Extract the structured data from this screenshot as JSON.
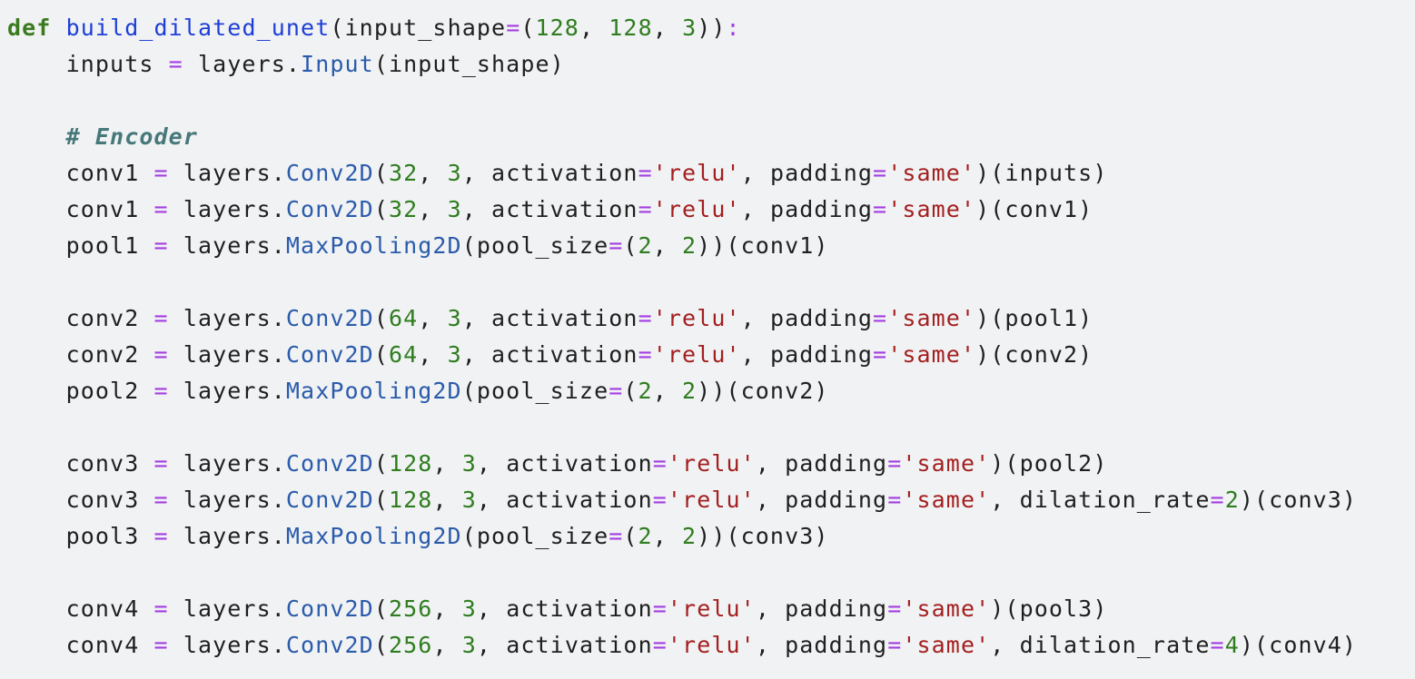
{
  "colors": {
    "background": "#f1f2f4",
    "text": "#1f1f1f",
    "keyword": "#3b7a1e",
    "function_name": "#1d3fd6",
    "class_name": "#2a5bab",
    "number": "#2f7d1f",
    "string": "#a31f1f",
    "operator": "#a43ee0",
    "comment": "#46787a"
  },
  "code_lines": [
    [
      [
        "kw",
        "def"
      ],
      [
        "tx",
        " "
      ],
      [
        "fn",
        "build_dilated_unet"
      ],
      [
        "tx",
        "(input_shape"
      ],
      [
        "op",
        "="
      ],
      [
        "tx",
        "("
      ],
      [
        "num",
        "128"
      ],
      [
        "tx",
        ", "
      ],
      [
        "num",
        "128"
      ],
      [
        "tx",
        ", "
      ],
      [
        "num",
        "3"
      ],
      [
        "tx",
        "))"
      ],
      [
        "op",
        ":"
      ]
    ],
    [
      [
        "tx",
        "    inputs "
      ],
      [
        "op",
        "="
      ],
      [
        "tx",
        " layers."
      ],
      [
        "cls",
        "Input"
      ],
      [
        "tx",
        "(input_shape)"
      ]
    ],
    [],
    [
      [
        "cm",
        "    # Encoder"
      ]
    ],
    [
      [
        "tx",
        "    conv1 "
      ],
      [
        "op",
        "="
      ],
      [
        "tx",
        " layers."
      ],
      [
        "cls",
        "Conv2D"
      ],
      [
        "tx",
        "("
      ],
      [
        "num",
        "32"
      ],
      [
        "tx",
        ", "
      ],
      [
        "num",
        "3"
      ],
      [
        "tx",
        ", activation"
      ],
      [
        "op",
        "="
      ],
      [
        "str",
        "'relu'"
      ],
      [
        "tx",
        ", padding"
      ],
      [
        "op",
        "="
      ],
      [
        "str",
        "'same'"
      ],
      [
        "tx",
        ")(inputs)"
      ]
    ],
    [
      [
        "tx",
        "    conv1 "
      ],
      [
        "op",
        "="
      ],
      [
        "tx",
        " layers."
      ],
      [
        "cls",
        "Conv2D"
      ],
      [
        "tx",
        "("
      ],
      [
        "num",
        "32"
      ],
      [
        "tx",
        ", "
      ],
      [
        "num",
        "3"
      ],
      [
        "tx",
        ", activation"
      ],
      [
        "op",
        "="
      ],
      [
        "str",
        "'relu'"
      ],
      [
        "tx",
        ", padding"
      ],
      [
        "op",
        "="
      ],
      [
        "str",
        "'same'"
      ],
      [
        "tx",
        ")(conv1)"
      ]
    ],
    [
      [
        "tx",
        "    pool1 "
      ],
      [
        "op",
        "="
      ],
      [
        "tx",
        " layers."
      ],
      [
        "cls",
        "MaxPooling2D"
      ],
      [
        "tx",
        "(pool_size"
      ],
      [
        "op",
        "="
      ],
      [
        "tx",
        "("
      ],
      [
        "num",
        "2"
      ],
      [
        "tx",
        ", "
      ],
      [
        "num",
        "2"
      ],
      [
        "tx",
        "))(conv1)"
      ]
    ],
    [],
    [
      [
        "tx",
        "    conv2 "
      ],
      [
        "op",
        "="
      ],
      [
        "tx",
        " layers."
      ],
      [
        "cls",
        "Conv2D"
      ],
      [
        "tx",
        "("
      ],
      [
        "num",
        "64"
      ],
      [
        "tx",
        ", "
      ],
      [
        "num",
        "3"
      ],
      [
        "tx",
        ", activation"
      ],
      [
        "op",
        "="
      ],
      [
        "str",
        "'relu'"
      ],
      [
        "tx",
        ", padding"
      ],
      [
        "op",
        "="
      ],
      [
        "str",
        "'same'"
      ],
      [
        "tx",
        ")(pool1)"
      ]
    ],
    [
      [
        "tx",
        "    conv2 "
      ],
      [
        "op",
        "="
      ],
      [
        "tx",
        " layers."
      ],
      [
        "cls",
        "Conv2D"
      ],
      [
        "tx",
        "("
      ],
      [
        "num",
        "64"
      ],
      [
        "tx",
        ", "
      ],
      [
        "num",
        "3"
      ],
      [
        "tx",
        ", activation"
      ],
      [
        "op",
        "="
      ],
      [
        "str",
        "'relu'"
      ],
      [
        "tx",
        ", padding"
      ],
      [
        "op",
        "="
      ],
      [
        "str",
        "'same'"
      ],
      [
        "tx",
        ")(conv2)"
      ]
    ],
    [
      [
        "tx",
        "    pool2 "
      ],
      [
        "op",
        "="
      ],
      [
        "tx",
        " layers."
      ],
      [
        "cls",
        "MaxPooling2D"
      ],
      [
        "tx",
        "(pool_size"
      ],
      [
        "op",
        "="
      ],
      [
        "tx",
        "("
      ],
      [
        "num",
        "2"
      ],
      [
        "tx",
        ", "
      ],
      [
        "num",
        "2"
      ],
      [
        "tx",
        "))(conv2)"
      ]
    ],
    [],
    [
      [
        "tx",
        "    conv3 "
      ],
      [
        "op",
        "="
      ],
      [
        "tx",
        " layers."
      ],
      [
        "cls",
        "Conv2D"
      ],
      [
        "tx",
        "("
      ],
      [
        "num",
        "128"
      ],
      [
        "tx",
        ", "
      ],
      [
        "num",
        "3"
      ],
      [
        "tx",
        ", activation"
      ],
      [
        "op",
        "="
      ],
      [
        "str",
        "'relu'"
      ],
      [
        "tx",
        ", padding"
      ],
      [
        "op",
        "="
      ],
      [
        "str",
        "'same'"
      ],
      [
        "tx",
        ")(pool2)"
      ]
    ],
    [
      [
        "tx",
        "    conv3 "
      ],
      [
        "op",
        "="
      ],
      [
        "tx",
        " layers."
      ],
      [
        "cls",
        "Conv2D"
      ],
      [
        "tx",
        "("
      ],
      [
        "num",
        "128"
      ],
      [
        "tx",
        ", "
      ],
      [
        "num",
        "3"
      ],
      [
        "tx",
        ", activation"
      ],
      [
        "op",
        "="
      ],
      [
        "str",
        "'relu'"
      ],
      [
        "tx",
        ", padding"
      ],
      [
        "op",
        "="
      ],
      [
        "str",
        "'same'"
      ],
      [
        "tx",
        ", dilation_rate"
      ],
      [
        "op",
        "="
      ],
      [
        "num",
        "2"
      ],
      [
        "tx",
        ")(conv3)"
      ]
    ],
    [
      [
        "tx",
        "    pool3 "
      ],
      [
        "op",
        "="
      ],
      [
        "tx",
        " layers."
      ],
      [
        "cls",
        "MaxPooling2D"
      ],
      [
        "tx",
        "(pool_size"
      ],
      [
        "op",
        "="
      ],
      [
        "tx",
        "("
      ],
      [
        "num",
        "2"
      ],
      [
        "tx",
        ", "
      ],
      [
        "num",
        "2"
      ],
      [
        "tx",
        "))(conv3)"
      ]
    ],
    [],
    [
      [
        "tx",
        "    conv4 "
      ],
      [
        "op",
        "="
      ],
      [
        "tx",
        " layers."
      ],
      [
        "cls",
        "Conv2D"
      ],
      [
        "tx",
        "("
      ],
      [
        "num",
        "256"
      ],
      [
        "tx",
        ", "
      ],
      [
        "num",
        "3"
      ],
      [
        "tx",
        ", activation"
      ],
      [
        "op",
        "="
      ],
      [
        "str",
        "'relu'"
      ],
      [
        "tx",
        ", padding"
      ],
      [
        "op",
        "="
      ],
      [
        "str",
        "'same'"
      ],
      [
        "tx",
        ")(pool3)"
      ]
    ],
    [
      [
        "tx",
        "    conv4 "
      ],
      [
        "op",
        "="
      ],
      [
        "tx",
        " layers."
      ],
      [
        "cls",
        "Conv2D"
      ],
      [
        "tx",
        "("
      ],
      [
        "num",
        "256"
      ],
      [
        "tx",
        ", "
      ],
      [
        "num",
        "3"
      ],
      [
        "tx",
        ", activation"
      ],
      [
        "op",
        "="
      ],
      [
        "str",
        "'relu'"
      ],
      [
        "tx",
        ", padding"
      ],
      [
        "op",
        "="
      ],
      [
        "str",
        "'same'"
      ],
      [
        "tx",
        ", dilation_rate"
      ],
      [
        "op",
        "="
      ],
      [
        "num",
        "4"
      ],
      [
        "tx",
        ")(conv4)"
      ]
    ]
  ]
}
